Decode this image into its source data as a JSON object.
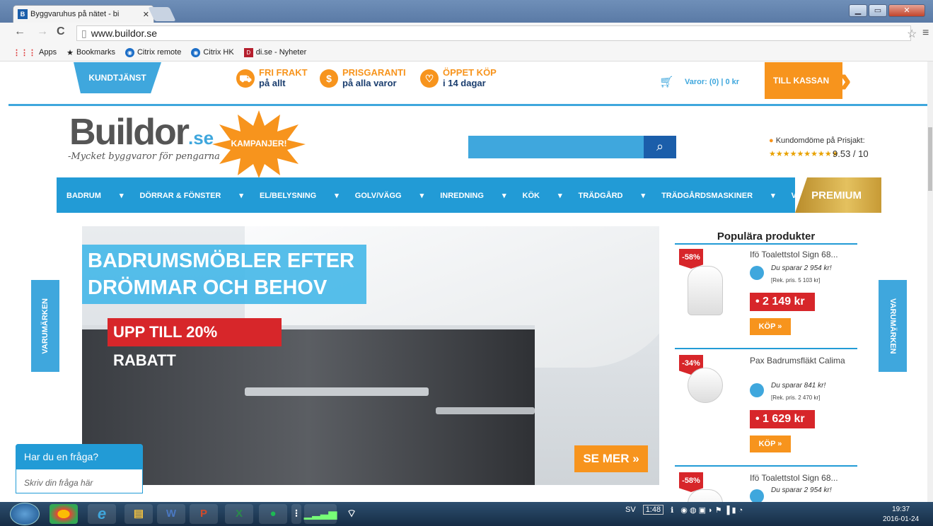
{
  "browser": {
    "tab_title": "Byggvaruhus på nätet - bi",
    "tab_favicon": "B",
    "url": "www.buildor.se",
    "bookmarks": [
      {
        "label": "Apps",
        "icon": "apps-icon"
      },
      {
        "label": "Bookmarks",
        "icon": "star-icon"
      },
      {
        "label": "Citrix remote",
        "icon": "citrix-icon"
      },
      {
        "label": "Citrix HK",
        "icon": "citrix-icon"
      },
      {
        "label": "di.se - Nyheter",
        "icon": "di-icon"
      }
    ]
  },
  "topbar": {
    "kundtjanst": "KUNDTJÄNST",
    "usp": [
      {
        "line1": "FRI FRAKT",
        "line2": "på allt",
        "icon": "truck-icon"
      },
      {
        "line1": "PRISGARANTI",
        "line2": "på alla varor",
        "icon": "dollar-icon"
      },
      {
        "line1": "ÖPPET KÖP",
        "line2": "i 14 dagar",
        "icon": "heart-icon"
      }
    ],
    "cart_text": "Varor: (0) | 0 kr",
    "checkout": "TILL KASSAN"
  },
  "header": {
    "logo_main": "Buildor",
    "logo_suffix": ".se",
    "slogan": "-Mycket byggvaror för pengarna",
    "kampanj": "KAMPANJER!",
    "search_placeholder": "",
    "rating_label": "Kundomdöme på Prisjakt:",
    "rating_stars": "★★★★★★★★★★",
    "rating_score": "9.53 / 10"
  },
  "nav": {
    "items": [
      "BADRUM",
      "DÖRRAR & FÖNSTER",
      "EL/BELYSNING",
      "GOLV/VÄGG",
      "INREDNING",
      "KÖK",
      "TRÄDGÅRD",
      "TRÄDGÅRDSMASKINER",
      "VVS"
    ],
    "premium": "PREMIUM"
  },
  "hero": {
    "headline_1": "BADRUMSMÖBLER EFTER",
    "headline_2": "DRÖMMAR OCH BEHOV",
    "sub": "UPP TILL 20% RABATT",
    "cta": "SE MER »"
  },
  "side": {
    "label": "VARUMÄRKEN"
  },
  "popular": {
    "title": "Populära produkter",
    "products": [
      {
        "discount": "-58%",
        "name": "Ifö Toalettstol Sign 68...",
        "save": "Du sparar 2 954 kr!",
        "rek": "[Rek. pris. 5 103 kr]",
        "price": "• 2 149 kr",
        "buy": "KÖP »"
      },
      {
        "discount": "-34%",
        "name": "Pax Badrumsfläkt Calima",
        "save": "Du sparar 841 kr!",
        "rek": "[Rek. pris. 2 470 kr]",
        "price": "• 1 629 kr",
        "buy": "KÖP »"
      },
      {
        "discount": "-58%",
        "name": "Ifö Toalettstol Sign 68...",
        "save": "Du sparar 2 954 kr!"
      }
    ]
  },
  "chat": {
    "title": "Har du en fråga?",
    "placeholder": "Skriv din fråga här"
  },
  "taskbar": {
    "lang": "SV",
    "battery": "1:48",
    "time": "19:37",
    "date": "2016-01-24"
  }
}
